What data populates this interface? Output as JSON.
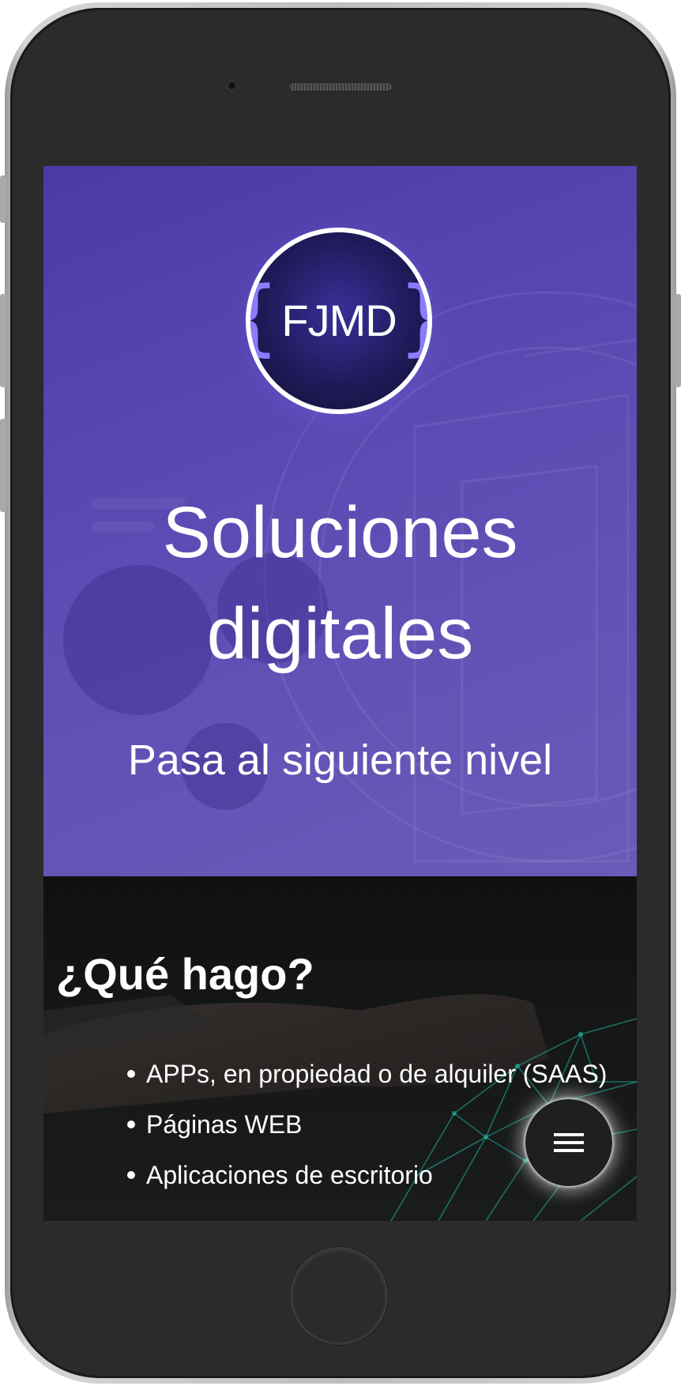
{
  "logo": {
    "open_brace": "{",
    "text": "FJMD",
    "close_brace": "}"
  },
  "hero": {
    "title_line1": "Soluciones",
    "title_line2": "digitales",
    "subtitle": "Pasa al siguiente nivel"
  },
  "services_section": {
    "title": "¿Qué hago?",
    "items": [
      "APPs, en propiedad o de alquiler (SAAS)",
      "Páginas WEB",
      "Aplicaciones de escritorio"
    ]
  },
  "menu_button": {
    "icon": "hamburger-menu-icon"
  },
  "colors": {
    "hero_purple": "#5b4cb4",
    "logo_brace": "#8b7cff",
    "section_dark": "#151717",
    "accent_teal": "#1fb5a0"
  }
}
